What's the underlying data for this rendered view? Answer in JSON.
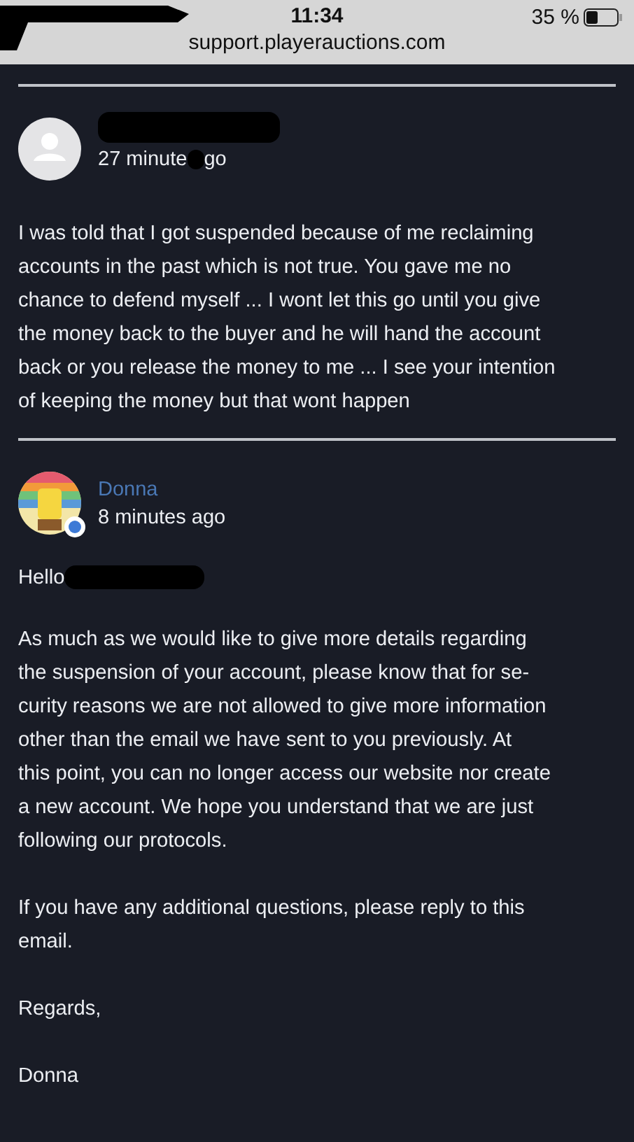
{
  "status_bar": {
    "time": "11:34",
    "url": "support.playerauctions.com",
    "battery": "35 %"
  },
  "messages": [
    {
      "author_redacted": true,
      "avatar": {
        "kind": "silhouette"
      },
      "time_parts": [
        "27 minute",
        "go"
      ],
      "paragraphs": [
        "I was told that I got suspended because of me reclaiming\naccounts in the past which is not true. You gave me no\nchance to defend myself ... I wont let this go until you give\nthe money back to the buyer and he will hand the account\nback or you release the money to me ... I see your intention\nof keeping the money but that wont happen"
      ]
    },
    {
      "author_redacted": false,
      "author": "Donna",
      "avatar": {
        "kind": "picture"
      },
      "time_parts": [
        "8 minutes ago"
      ],
      "greeting": "Hello",
      "paragraphs": [
        "As much as we would like to give more details regarding\nthe suspension of your account, please know that for se-\ncurity reasons we are not allowed to give more information\nother than the email we have sent to you previously. At\nthis point, you can no longer access our website nor create\na new account. We hope you understand that we are just\nfollowing our protocols.",
        "If you have any additional questions, please reply to this\nemail.",
        "Regards,",
        "Donna"
      ]
    }
  ]
}
